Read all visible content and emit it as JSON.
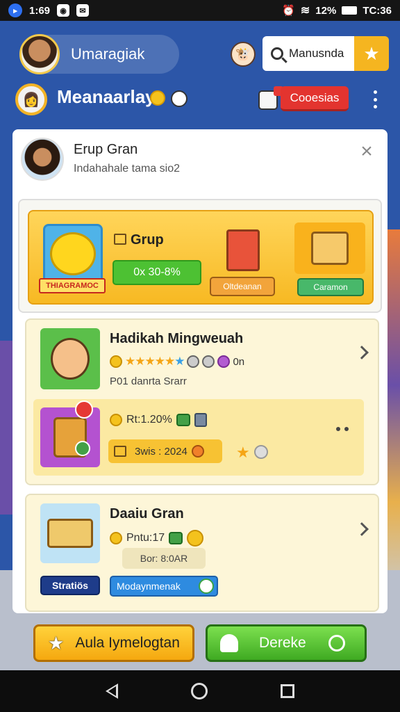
{
  "status_bar": {
    "time": "1:69",
    "battery_text": "12%",
    "clock_right": "TC:36"
  },
  "header": {
    "user_name": "Umaragiak",
    "search_placeholder": "Manusnda",
    "title": "Meanaarlay",
    "coupons_label": "Cooesias"
  },
  "card": {
    "title": "Erup Gran",
    "subtitle": "Indahahale tama sio2",
    "group": {
      "emoji_label": "THIAGRAMOC",
      "name": "Grup",
      "percent": "0x 30-8%",
      "open_label": "Oltdeanan",
      "claim_label": "Caramon"
    },
    "mission": {
      "title": "Hadikah Mingweuah",
      "rating_suffix": "0n",
      "note": "P01 danrta Srarr",
      "sub_percent": "Rt:1.20%",
      "sub_date": "3wis : 2024"
    },
    "prize": {
      "title": "Daaiu Gran",
      "amount": "Pntu:17",
      "date": "Bor: 8:0AR",
      "status": "Stratiös",
      "map_label": "Modaynmenak"
    }
  },
  "actions": {
    "invite_label": "Aula Iymelogtan",
    "receive_label": "Dereke"
  },
  "colors": {
    "background": "#2c56a8",
    "accent_yellow": "#f5b520",
    "accent_green": "#3faa22",
    "accent_red": "#e3342f"
  }
}
